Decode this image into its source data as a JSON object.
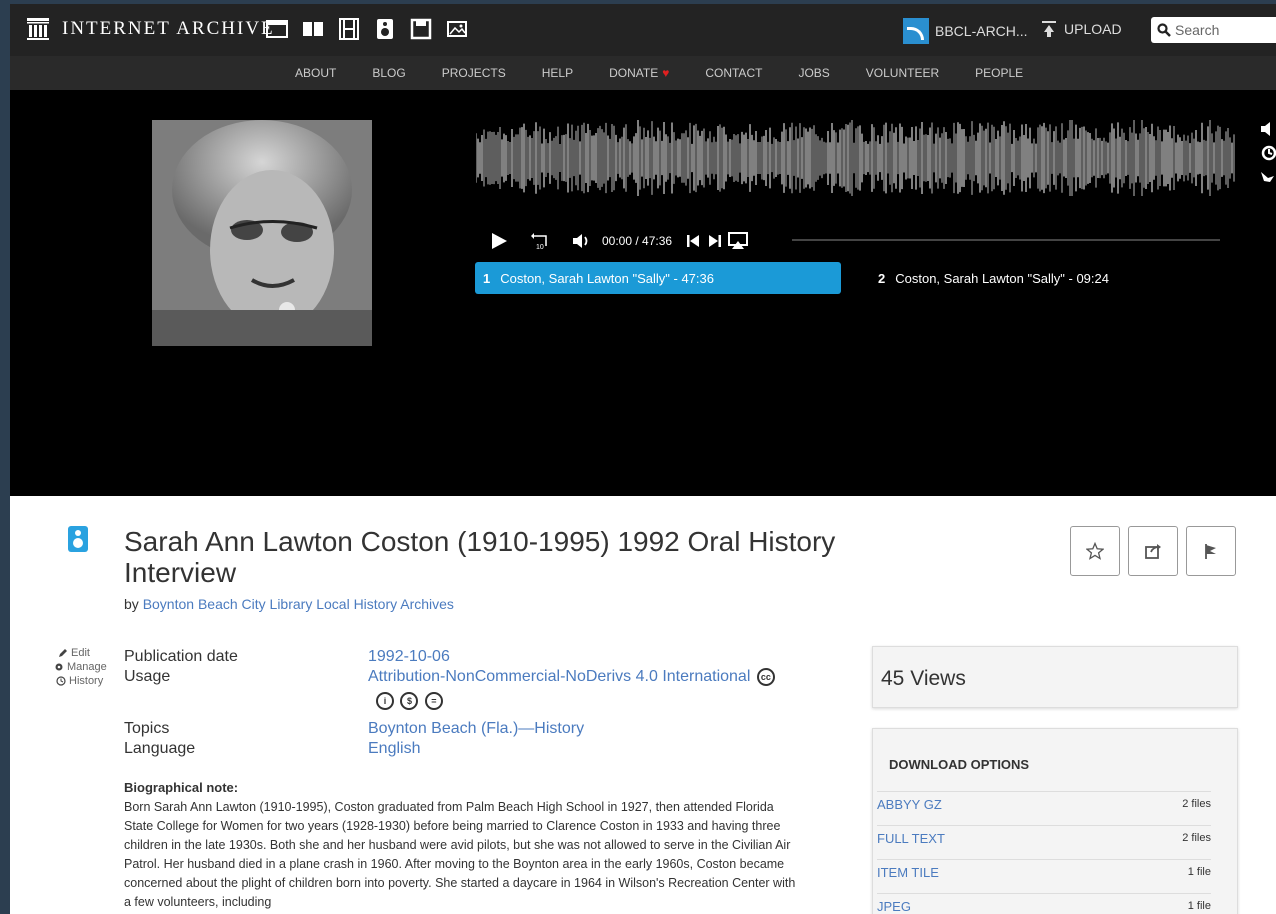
{
  "header": {
    "logo_text": "INTERNET ARCHIVE",
    "account_name": "BBCL-ARCH...",
    "upload_label": "UPLOAD",
    "search_placeholder": "Search",
    "media_icons": [
      "web-icon",
      "texts-icon",
      "video-icon",
      "audio-icon",
      "software-icon",
      "images-icon"
    ]
  },
  "nav": {
    "items": [
      "ABOUT",
      "BLOG",
      "PROJECTS",
      "HELP",
      "DONATE",
      "CONTACT",
      "JOBS",
      "VOLUNTEER",
      "PEOPLE"
    ]
  },
  "player": {
    "time": "00:00 / 47:36",
    "tracks": [
      {
        "num": "1",
        "title": "Coston, Sarah Lawton \"Sally\"  - 47:36"
      },
      {
        "num": "2",
        "title": "Coston, Sarah Lawton \"Sally\"  - 09:24"
      }
    ]
  },
  "item": {
    "title": "Sarah Ann Lawton Coston (1910-1995) 1992 Oral History Interview",
    "by": "by",
    "creator": "Boynton Beach City Library Local History Archives"
  },
  "edit_menu": [
    "Edit",
    "Manage",
    "History"
  ],
  "metadata": [
    {
      "label": "Publication date",
      "value": "1992-10-06"
    },
    {
      "label": "Usage",
      "value": "Attribution-NonCommercial-NoDerivs 4.0 International"
    },
    {
      "label": "Topics",
      "value": "Boynton Beach (Fla.)—History"
    },
    {
      "label": "Language",
      "value": "English"
    }
  ],
  "bio": {
    "heading": "Biographical note:",
    "text": "Born Sarah Ann Lawton (1910-1995), Coston graduated from Palm Beach High School in 1927, then attended Florida State College for Women for two years (1928-1930) before being married to Clarence Coston in 1933 and having three children in the late 1930s. Both she and her husband were avid pilots, but she was not allowed to serve in the Civilian Air Patrol. Her husband died in a plane crash in 1960. After moving to the Boynton area in the early 1960s, Coston became concerned about the plight of children born into poverty. She started a daycare in 1964 in Wilson's Recreation Center with a few volunteers, including"
  },
  "views": "45 Views",
  "downloads": {
    "heading": "DOWNLOAD OPTIONS",
    "rows": [
      {
        "name": "ABBYY GZ",
        "count": "2 files"
      },
      {
        "name": "FULL TEXT",
        "count": "2 files"
      },
      {
        "name": "ITEM TILE",
        "count": "1 file"
      },
      {
        "name": "JPEG",
        "count": "1 file"
      }
    ]
  }
}
